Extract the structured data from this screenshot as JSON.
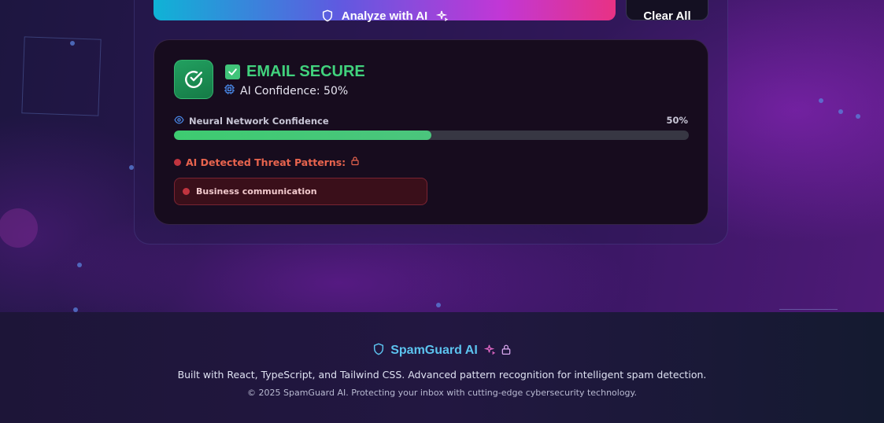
{
  "toolbar": {
    "analyze_label": "Analyze with AI",
    "clear_label": "Clear All"
  },
  "result": {
    "status_title": "EMAIL SECURE",
    "confidence_text": "AI Confidence: 50%",
    "neural_label": "Neural Network Confidence",
    "neural_percent_label": "50%",
    "neural_confidence": 0.5,
    "threat_heading": "AI Detected Threat Patterns:",
    "threats": [
      "Business communication"
    ]
  },
  "footer": {
    "brand": "SpamGuard AI",
    "description": "Built with React, TypeScript, and Tailwind CSS. Advanced pattern recognition for intelligent spam detection.",
    "copyright": "© 2025 SpamGuard AI. Protecting your inbox with cutting-edge cybersecurity technology."
  },
  "icons": {
    "analyze": "shield-icon",
    "sparkle": "sparkles-icon",
    "status": "check-circle-icon",
    "status_badge": "check-square-icon",
    "cpu": "cpu-icon",
    "eye": "eye-icon",
    "lock": "lock-icon"
  },
  "colors": {
    "secure_green": "#41d27d",
    "threat_red": "#e8644e",
    "brand_blue": "#5cc3ef",
    "sparkle_pink": "#e066c4"
  }
}
